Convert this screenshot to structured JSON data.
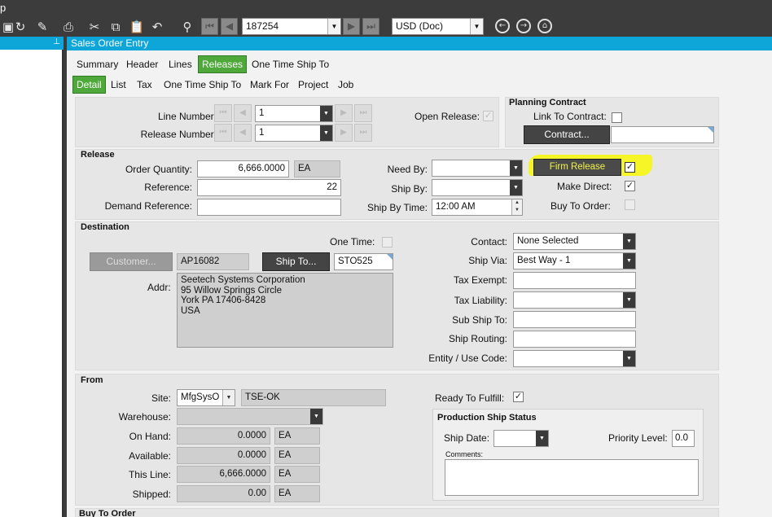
{
  "menu": {
    "fragment": "p"
  },
  "toolbar": {
    "record_value": "187254",
    "currency_value": "USD (Doc)"
  },
  "window": {
    "title": "Sales Order Entry"
  },
  "tabs_main": [
    "Summary",
    "Header",
    "Lines",
    "Releases",
    "One Time Ship To"
  ],
  "tabs_sub": [
    "Detail",
    "List",
    "Tax",
    "One Time Ship To",
    "Mark For",
    "Project",
    "Job"
  ],
  "line_info": {
    "line_number_label": "Line Number:",
    "line_number": "1",
    "release_number_label": "Release Number:",
    "release_number": "1",
    "open_release_label": "Open Release:",
    "open_release_checked": true
  },
  "planning": {
    "title": "Planning Contract",
    "link_label": "Link To Contract:",
    "link_checked": false,
    "contract_button": "Contract...",
    "contract_value": ""
  },
  "release": {
    "title": "Release",
    "order_qty_label": "Order Quantity:",
    "order_qty": "6,666.0000",
    "order_qty_uom": "EA",
    "reference_label": "Reference:",
    "reference": "22",
    "demand_ref_label": "Demand Reference:",
    "demand_ref": "",
    "need_by_label": "Need By:",
    "need_by": "",
    "ship_by_label": "Ship By:",
    "ship_by": "",
    "ship_by_time_label": "Ship By Time:",
    "ship_by_time": "12:00 AM",
    "firm_release_label": "Firm Release",
    "firm_release_checked": true,
    "make_direct_label": "Make Direct:",
    "make_direct_checked": true,
    "buy_to_order_label": "Buy To Order:",
    "buy_to_order_checked": false,
    "highlight_color": "#f7f71a"
  },
  "destination": {
    "title": "Destination",
    "one_time_label": "One Time:",
    "one_time_checked": false,
    "customer_button": "Customer...",
    "customer_id": "AP16082",
    "ship_to_button": "Ship To...",
    "ship_to_id": "STO525",
    "addr_label": "Addr:",
    "address": "Seetech Systems Corporation\n95 Willow Springs Circle\nYork PA 17406-8428\nUSA",
    "contact_label": "Contact:",
    "contact": "None Selected",
    "ship_via_label": "Ship Via:",
    "ship_via": "Best Way - 1",
    "tax_exempt_label": "Tax Exempt:",
    "tax_exempt": "",
    "tax_liability_label": "Tax Liability:",
    "tax_liability": "",
    "sub_ship_to_label": "Sub Ship To:",
    "sub_ship_to": "",
    "ship_routing_label": "Ship Routing:",
    "ship_routing": "",
    "entity_label": "Entity / Use Code:",
    "entity": ""
  },
  "from": {
    "title": "From",
    "site_label": "Site:",
    "site": "MfgSysO",
    "site_desc": "TSE-OK",
    "warehouse_label": "Warehouse:",
    "warehouse": "",
    "on_hand_label": "On Hand:",
    "on_hand": "0.0000",
    "on_hand_uom": "EA",
    "available_label": "Available:",
    "available": "0.0000",
    "available_uom": "EA",
    "this_line_label": "This Line:",
    "this_line": "6,666.0000",
    "this_line_uom": "EA",
    "shipped_label": "Shipped:",
    "shipped": "0.00",
    "shipped_uom": "EA",
    "ready_label": "Ready To Fulfill:",
    "ready_checked": true
  },
  "prod_status": {
    "title": "Production Ship Status",
    "ship_date_label": "Ship Date:",
    "ship_date": "",
    "priority_label": "Priority Level:",
    "priority": "0.0",
    "comments_label": "Comments:",
    "comments": ""
  },
  "buy_to_order_section": {
    "title": "Buy To Order"
  }
}
